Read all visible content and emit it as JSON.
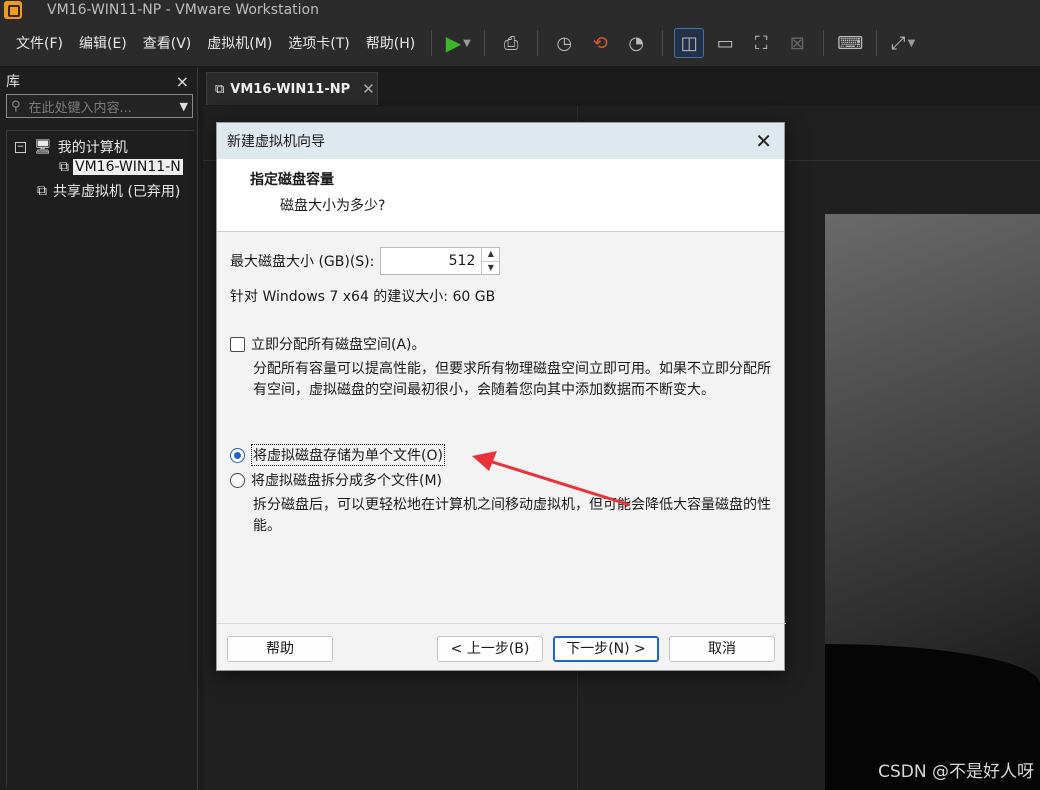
{
  "window": {
    "title": "VM16-WIN11-NP - VMware Workstation"
  },
  "menu": [
    "文件(F)",
    "编辑(E)",
    "查看(V)",
    "虚拟机(M)",
    "选项卡(T)",
    "帮助(H)"
  ],
  "toolbar_icons": [
    "play-icon",
    "send-keys-icon",
    "snapshot-icon",
    "revert-snapshot-icon",
    "snapshot-manager-icon",
    "library-view-icon",
    "thumbnail-view-icon",
    "fullscreen-icon",
    "unity-icon",
    "console-icon",
    "stretch-icon"
  ],
  "sidebar": {
    "title": "库",
    "close": "×",
    "search_placeholder": "在此处键入内容...",
    "items": {
      "my_computer": "我的计算机",
      "vm": "VM16-WIN11-N",
      "shared": "共享虚拟机 (已弃用)"
    }
  },
  "tab": {
    "label": "VM16-WIN11-NP",
    "close": "✕"
  },
  "dialog": {
    "title": "新建虚拟机向导",
    "close": "✕",
    "heading": "指定磁盘容量",
    "subheading": "磁盘大小为多少?",
    "disk_size_label": "最大磁盘大小 (GB)(S):",
    "disk_size_value": "512",
    "recommended": "针对 Windows 7 x64 的建议大小: 60 GB",
    "allocate_label": "立即分配所有磁盘空间(A)。",
    "allocate_checked": false,
    "allocate_desc": "分配所有容量可以提高性能，但要求所有物理磁盘空间立即可用。如果不立即分配所有空间，虚拟磁盘的空间最初很小，会随着您向其中添加数据而不断变大。",
    "single_file_label": "将虚拟磁盘存储为单个文件(O)",
    "single_file_selected": true,
    "multi_file_label": "将虚拟磁盘拆分成多个文件(M)",
    "multi_file_desc": "拆分磁盘后，可以更轻松地在计算机之间移动虚拟机，但可能会降低大容量磁盘的性能。",
    "buttons": {
      "help": "帮助",
      "back": "< 上一步(B)",
      "next": "下一步(N) >",
      "cancel": "取消"
    }
  },
  "annotation_color": "#e8333a",
  "watermark": "CSDN @不是好人呀"
}
